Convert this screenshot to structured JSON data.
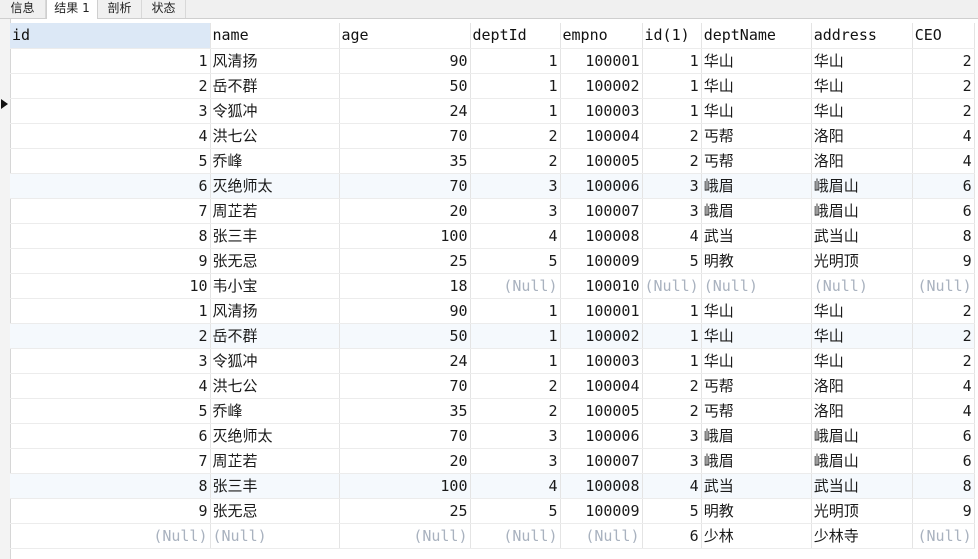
{
  "tabs": [
    "信息",
    "结果 1",
    "剖析",
    "状态"
  ],
  "active_tab": 1,
  "columns": [
    "id",
    "name",
    "age",
    "deptId",
    "empno",
    "id(1)",
    "deptName",
    "address",
    "CEO"
  ],
  "null_text": "(Null)",
  "rows": [
    [
      "1",
      "风清扬",
      "90",
      "1",
      "100001",
      "1",
      "华山",
      "华山",
      "2"
    ],
    [
      "2",
      "岳不群",
      "50",
      "1",
      "100002",
      "1",
      "华山",
      "华山",
      "2"
    ],
    [
      "3",
      "令狐冲",
      "24",
      "1",
      "100003",
      "1",
      "华山",
      "华山",
      "2"
    ],
    [
      "4",
      "洪七公",
      "70",
      "2",
      "100004",
      "2",
      "丐帮",
      "洛阳",
      "4"
    ],
    [
      "5",
      "乔峰",
      "35",
      "2",
      "100005",
      "2",
      "丐帮",
      "洛阳",
      "4"
    ],
    [
      "6",
      "灭绝师太",
      "70",
      "3",
      "100006",
      "3",
      "峨眉",
      "峨眉山",
      "6"
    ],
    [
      "7",
      "周芷若",
      "20",
      "3",
      "100007",
      "3",
      "峨眉",
      "峨眉山",
      "6"
    ],
    [
      "8",
      "张三丰",
      "100",
      "4",
      "100008",
      "4",
      "武当",
      "武当山",
      "8"
    ],
    [
      "9",
      "张无忌",
      "25",
      "5",
      "100009",
      "5",
      "明教",
      "光明顶",
      "9"
    ],
    [
      "10",
      "韦小宝",
      "18",
      null,
      "100010",
      null,
      null,
      null,
      null
    ],
    [
      "1",
      "风清扬",
      "90",
      "1",
      "100001",
      "1",
      "华山",
      "华山",
      "2"
    ],
    [
      "2",
      "岳不群",
      "50",
      "1",
      "100002",
      "1",
      "华山",
      "华山",
      "2"
    ],
    [
      "3",
      "令狐冲",
      "24",
      "1",
      "100003",
      "1",
      "华山",
      "华山",
      "2"
    ],
    [
      "4",
      "洪七公",
      "70",
      "2",
      "100004",
      "2",
      "丐帮",
      "洛阳",
      "4"
    ],
    [
      "5",
      "乔峰",
      "35",
      "2",
      "100005",
      "2",
      "丐帮",
      "洛阳",
      "4"
    ],
    [
      "6",
      "灭绝师太",
      "70",
      "3",
      "100006",
      "3",
      "峨眉",
      "峨眉山",
      "6"
    ],
    [
      "7",
      "周芷若",
      "20",
      "3",
      "100007",
      "3",
      "峨眉",
      "峨眉山",
      "6"
    ],
    [
      "8",
      "张三丰",
      "100",
      "4",
      "100008",
      "4",
      "武当",
      "武当山",
      "8"
    ],
    [
      "9",
      "张无忌",
      "25",
      "5",
      "100009",
      "5",
      "明教",
      "光明顶",
      "9"
    ],
    [
      null,
      null,
      null,
      null,
      null,
      "6",
      "少林",
      "少林寺",
      null
    ]
  ],
  "current_row_index": 1,
  "highlight_rows": [
    5,
    11,
    17
  ],
  "colors": {
    "header_selected_bg": "#dce8f6",
    "null_text": "#a9b2bf",
    "row_highlight": "#f5f9fd"
  }
}
